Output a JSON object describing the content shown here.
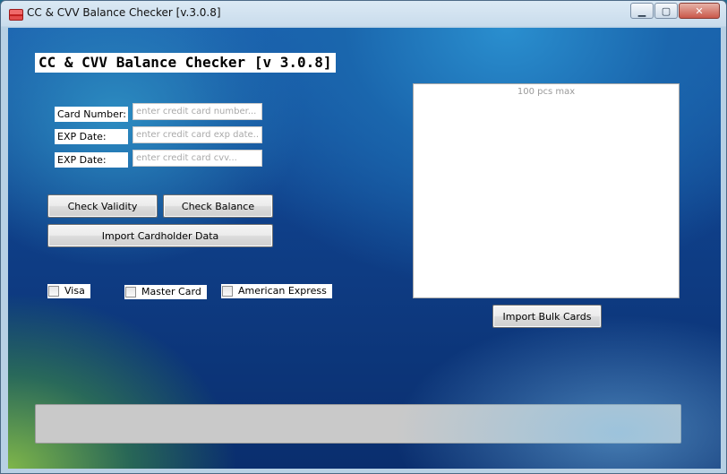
{
  "window": {
    "title": "CC & CVV Balance Checker [v.3.0.8]",
    "controls": {
      "minimize": "▁",
      "maximize": "▢",
      "close": "✕"
    }
  },
  "heading": "CC & CVV Balance Checker [v 3.0.8]",
  "fields": {
    "card_number": {
      "label": "Card Number:",
      "placeholder": "enter credit card number...",
      "value": ""
    },
    "exp_date": {
      "label": "EXP Date:",
      "placeholder": "enter credit card exp date...",
      "value": ""
    },
    "cvv": {
      "label": "EXP Date:",
      "placeholder": "enter credit card cvv...",
      "value": ""
    }
  },
  "buttons": {
    "check_validity": "Check Validity",
    "check_balance": "Check Balance",
    "import_cardholder": "Import Cardholder Data",
    "import_bulk": "Import Bulk Cards"
  },
  "checkboxes": [
    {
      "label": "Visa",
      "checked": false
    },
    {
      "label": "Master Card",
      "checked": false
    },
    {
      "label": "American Express",
      "checked": false
    }
  ],
  "bulk_panel": {
    "placeholder": "100 pcs max"
  },
  "progress": {
    "fraction": 0
  },
  "colors": {
    "progress_track": "#c9c9c9",
    "background_top": "#1b5fae",
    "background_bottom": "#0a2e6e"
  }
}
